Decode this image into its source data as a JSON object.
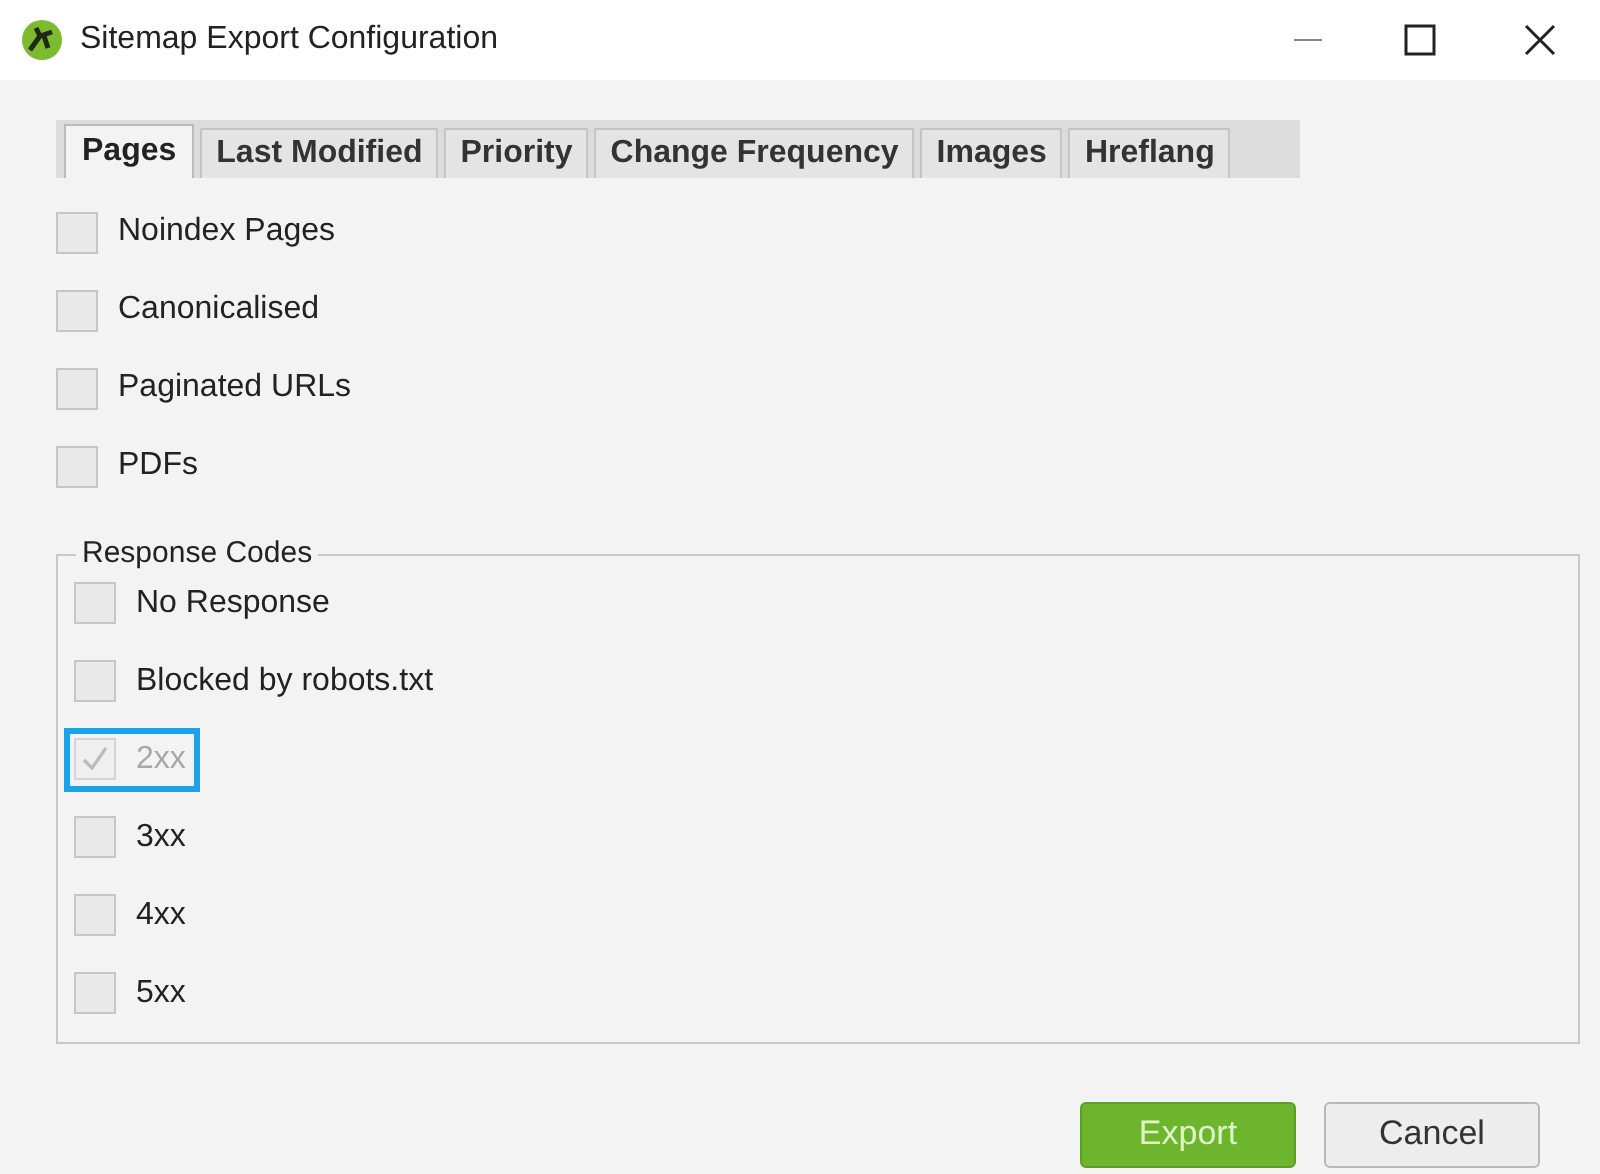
{
  "window": {
    "title": "Sitemap Export Configuration"
  },
  "tabs": [
    {
      "label": "Pages",
      "selected": true
    },
    {
      "label": "Last Modified",
      "selected": false
    },
    {
      "label": "Priority",
      "selected": false
    },
    {
      "label": "Change Frequency",
      "selected": false
    },
    {
      "label": "Images",
      "selected": false
    },
    {
      "label": "Hreflang",
      "selected": false
    }
  ],
  "options": [
    {
      "label": "Noindex Pages",
      "checked": false,
      "disabled": false,
      "highlighted": false
    },
    {
      "label": "Canonicalised",
      "checked": false,
      "disabled": false,
      "highlighted": false
    },
    {
      "label": "Paginated URLs",
      "checked": false,
      "disabled": false,
      "highlighted": false
    },
    {
      "label": "PDFs",
      "checked": false,
      "disabled": false,
      "highlighted": false
    }
  ],
  "response_codes": {
    "title": "Response Codes",
    "options": [
      {
        "label": "No Response",
        "checked": false,
        "disabled": false,
        "highlighted": false
      },
      {
        "label": "Blocked by robots.txt",
        "checked": false,
        "disabled": false,
        "highlighted": false
      },
      {
        "label": "2xx",
        "checked": true,
        "disabled": true,
        "highlighted": true
      },
      {
        "label": "3xx",
        "checked": false,
        "disabled": false,
        "highlighted": false
      },
      {
        "label": "4xx",
        "checked": false,
        "disabled": false,
        "highlighted": false
      },
      {
        "label": "5xx",
        "checked": false,
        "disabled": false,
        "highlighted": false
      }
    ]
  },
  "buttons": [
    {
      "label": "Export",
      "kind": "primary"
    },
    {
      "label": "Cancel",
      "kind": "secondary"
    }
  ]
}
